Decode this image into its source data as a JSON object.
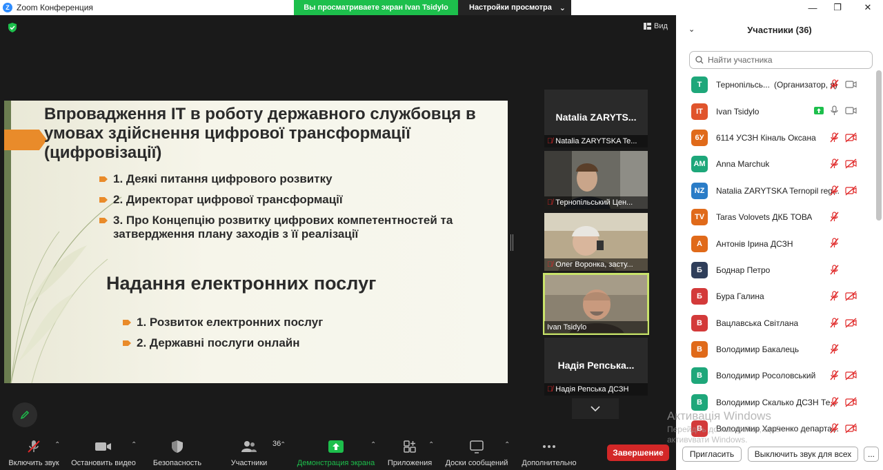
{
  "window": {
    "title": "Zoom Конференция",
    "minimize": "—",
    "maximize": "❐",
    "close": "✕"
  },
  "share_banner": {
    "viewing_text": "Вы просматриваете экран Ivan Tsidylo",
    "view_options": "Настройки просмотра"
  },
  "view_button": "Вид",
  "slide": {
    "title": "Впровадження ІТ в роботу державного службовця в умовах здійснення цифрової трансформації (цифровізації)",
    "bullets_top": [
      "1. Деякі питання цифрового розвитку",
      "2. Директорат цифрової трансформації",
      "3. Про Концепцію розвитку цифрових компетентностей та затвердження плану заходів з її реалізації"
    ],
    "title2": "Надання електронних послуг",
    "bullets_bottom": [
      "1. Розвиток електронних послуг",
      "2. Державні послуги онлайн"
    ],
    "accent_color": "#e98b2a"
  },
  "tiles": [
    {
      "center_name": "Natalia  ZARYTS...",
      "caption": "Natalia ZARYTSKA Te..."
    },
    {
      "caption": "Тернопільський Цен..."
    },
    {
      "caption": "Олег Воронка, засту..."
    },
    {
      "caption": "Ivan Tsidylo"
    },
    {
      "center_name": "Надія  Репська...",
      "caption": "Надія Репська ДСЗН"
    }
  ],
  "toolbar": {
    "mute": "Включить звук",
    "video": "Остановить видео",
    "security": "Безопасность",
    "participants": "Участники",
    "participants_count": "36",
    "share": "Демонстрация экрана",
    "apps": "Приложения",
    "whiteboard": "Доски сообщений",
    "more": "Дополнительно",
    "end": "Завершение"
  },
  "panel": {
    "title": "Участники (36)",
    "search_placeholder": "Найти участника",
    "invite": "Пригласить",
    "mute_all": "Выключить звук для всех",
    "more": "..."
  },
  "participants": [
    {
      "initials": "T",
      "color": "#1ea77a",
      "name": "Тернопільсь...",
      "note": "(Организатор, я)",
      "mic": "muted-gray",
      "cam": "on"
    },
    {
      "initials": "IT",
      "color": "#e0542c",
      "name": "Ivan Tsidylo",
      "note": "",
      "share": true,
      "mic": "on",
      "cam": "on"
    },
    {
      "initials": "6У",
      "color": "#e06a1a",
      "name": "6114 УСЗН Кіналь Оксана",
      "note": "",
      "mic": "muted",
      "cam": "off"
    },
    {
      "initials": "AM",
      "color": "#1ea77a",
      "name": "Anna Marchuk",
      "note": "",
      "mic": "muted",
      "cam": "off"
    },
    {
      "initials": "NZ",
      "color": "#2a7cc7",
      "name": "Natalia ZARYTSKA Ternopil reg...",
      "note": "",
      "mic": "muted",
      "cam": "off"
    },
    {
      "initials": "TV",
      "color": "#e06a1a",
      "name": "Taras Volovets ДКБ ТОВА",
      "note": "",
      "mic": "muted",
      "cam": "none"
    },
    {
      "initials": "А",
      "color": "#e06a1a",
      "name": "Антонів Ірина ДСЗН",
      "note": "",
      "mic": "muted",
      "cam": "none"
    },
    {
      "initials": "Б",
      "color": "#2f3e5a",
      "name": "Боднар Петро",
      "note": "",
      "mic": "muted",
      "cam": "none"
    },
    {
      "initials": "Б",
      "color": "#d33a3a",
      "name": "Бура Галина",
      "note": "",
      "mic": "muted",
      "cam": "off"
    },
    {
      "initials": "В",
      "color": "#d33a3a",
      "name": "Вацлавська Світлана",
      "note": "",
      "mic": "muted",
      "cam": "off"
    },
    {
      "initials": "В",
      "color": "#e06a1a",
      "name": "Володимир Бакалець",
      "note": "",
      "mic": "muted",
      "cam": "none"
    },
    {
      "initials": "В",
      "color": "#1ea77a",
      "name": "Володимир Росоловський",
      "note": "",
      "mic": "muted",
      "cam": "off"
    },
    {
      "initials": "В",
      "color": "#1ea77a",
      "name": "Володимир Скалько ДСЗН Те...",
      "note": "",
      "mic": "muted",
      "cam": "off"
    },
    {
      "initials": "В",
      "color": "#d33a3a",
      "name": "Володимир Харченко департа...",
      "note": "",
      "mic": "muted",
      "cam": "off"
    }
  ],
  "watermark": {
    "line1": "Активація Windows",
    "line2": "Перейдіть до настройок, щоб активувати Windows."
  }
}
